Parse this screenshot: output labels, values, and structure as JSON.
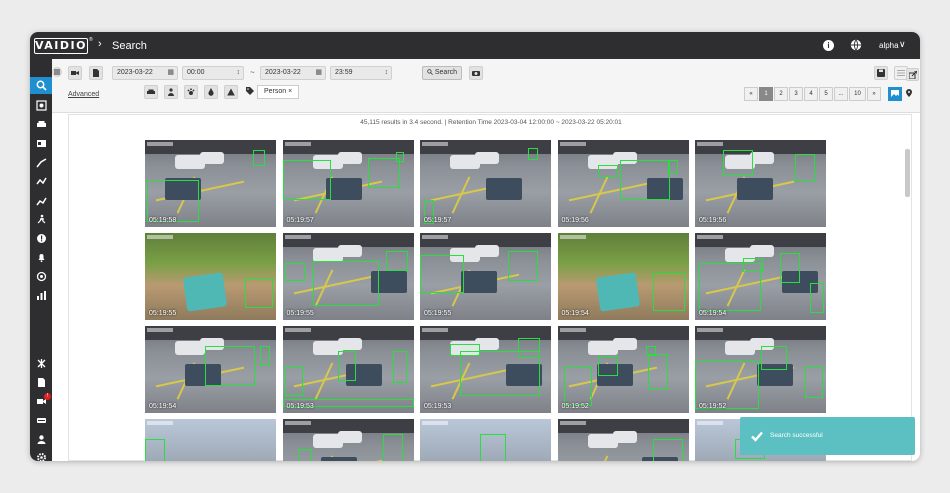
{
  "app": {
    "logo": "VAIDIO",
    "logo_reg": "®",
    "page_title": "Search",
    "user": "alpha"
  },
  "icons": {
    "info": "info-icon",
    "globe": "globe-icon",
    "chevron": "chevron-down-icon"
  },
  "colors": {
    "accent": "#1f8fd0",
    "topbar": "#2e2e30",
    "detection_box": "#27e040",
    "toast": "#5cc0c2",
    "badge": "#e02020"
  },
  "filters": {
    "start_date": "2023-03-22",
    "start_time": "00:00",
    "separator": "~",
    "end_date": "2023-03-22",
    "end_time": "23:59",
    "search_label": "Search",
    "advanced_label": "Advanced",
    "tag": "Person",
    "tag_close": "×"
  },
  "pagination": {
    "prev": "«",
    "pages": [
      "1",
      "2",
      "3",
      "4",
      "5",
      "...",
      "10"
    ],
    "next": "»",
    "current": "1"
  },
  "results": {
    "summary": "45,115 results in 3.4 second. | Retention Time 2023-03-04 12:00:00 ~ 2023-03-22 05:20:01",
    "tiles": [
      {
        "time": "05:19:58",
        "kind": "road"
      },
      {
        "time": "05:19:57",
        "kind": "road"
      },
      {
        "time": "05:19:57",
        "kind": "road"
      },
      {
        "time": "05:19:56",
        "kind": "road"
      },
      {
        "time": "05:19:56",
        "kind": "road"
      },
      {
        "time": "05:19:55",
        "kind": "park"
      },
      {
        "time": "05:19:55",
        "kind": "road"
      },
      {
        "time": "05:19:55",
        "kind": "road"
      },
      {
        "time": "05:19:54",
        "kind": "park"
      },
      {
        "time": "05:19:54",
        "kind": "road"
      },
      {
        "time": "05:19:54",
        "kind": "road"
      },
      {
        "time": "05:19:53",
        "kind": "road"
      },
      {
        "time": "05:19:53",
        "kind": "road"
      },
      {
        "time": "05:19:52",
        "kind": "road"
      },
      {
        "time": "05:19:52",
        "kind": "road"
      },
      {
        "time": "",
        "kind": "street"
      },
      {
        "time": "",
        "kind": "road"
      },
      {
        "time": "",
        "kind": "street"
      },
      {
        "time": "",
        "kind": "road"
      },
      {
        "time": "",
        "kind": "street"
      }
    ]
  },
  "notification": {
    "message": "Search successful"
  }
}
